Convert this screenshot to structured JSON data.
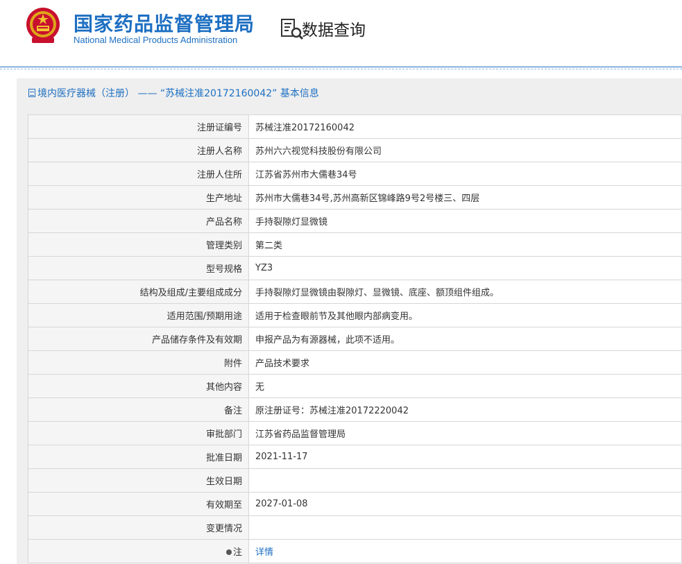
{
  "header": {
    "brand_cn": "国家药品监督管理局",
    "brand_en": "National Medical Products Administration",
    "section_title": "数据查询",
    "emblem_icon": "national-emblem-icon",
    "section_icon": "document-search-icon",
    "brand_color": "#1d6fc2"
  },
  "panel": {
    "title": "境内医疗器械（注册） —— “苏械注准20172160042” 基本信息",
    "title_icon": "document-icon"
  },
  "rows": [
    {
      "label": "注册证编号",
      "value": "苏械注准20172160042"
    },
    {
      "label": "注册人名称",
      "value": "苏州六六视觉科技股份有限公司"
    },
    {
      "label": "注册人住所",
      "value": "江苏省苏州市大儒巷34号"
    },
    {
      "label": "生产地址",
      "value": "苏州市大儒巷34号,苏州高新区锦峰路9号2号楼三、四层"
    },
    {
      "label": "产品名称",
      "value": "手持裂隙灯显微镜"
    },
    {
      "label": "管理类别",
      "value": "第二类"
    },
    {
      "label": "型号规格",
      "value": "YZ3"
    },
    {
      "label": "结构及组成/主要组成成分",
      "value": "手持裂隙灯显微镜由裂隙灯、显微镜、底座、额顶组件组成。"
    },
    {
      "label": "适用范围/预期用途",
      "value": "适用于检查眼前节及其他眼内部病变用。"
    },
    {
      "label": "产品储存条件及有效期",
      "value": "申报产品为有源器械，此项不适用。"
    },
    {
      "label": "附件",
      "value": "产品技术要求"
    },
    {
      "label": "其他内容",
      "value": "无"
    },
    {
      "label": "备注",
      "value": "原注册证号：苏械注准20172220042"
    },
    {
      "label": "审批部门",
      "value": "江苏省药品监督管理局"
    },
    {
      "label": "批准日期",
      "value": "2021-11-17"
    },
    {
      "label": "生效日期",
      "value": ""
    },
    {
      "label": "有效期至",
      "value": "2027-01-08"
    },
    {
      "label": "变更情况",
      "value": ""
    },
    {
      "label": "注",
      "value": "详情",
      "label_icon": "bulb-icon"
    }
  ]
}
